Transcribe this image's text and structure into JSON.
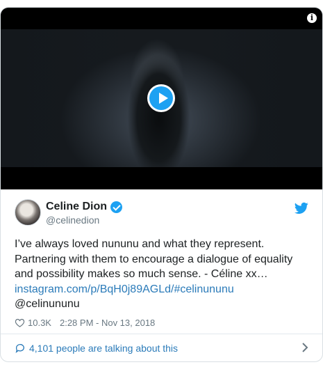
{
  "video": {
    "info_icon_glyph": "i",
    "play_icon": "play-icon"
  },
  "tweet": {
    "author_name": "Celine Dion",
    "handle": "@celinedion",
    "verified": true,
    "text_main": "I’ve always loved nununu and what they represent. Partnering with them to encourage a dialogue of equality and possibility makes so much sense. - Céline xx…",
    "link_text": "instagram.com/p/BqH0j89AGLd/#celinununu",
    "text_after": " @celinununu",
    "likes": "10.3K",
    "timestamp": "2:28 PM - Nov 13, 2018"
  },
  "footer": {
    "talking_text": "4,101 people are talking about this"
  },
  "colors": {
    "twitter_blue": "#1da1f2",
    "link_blue": "#2b7bb9",
    "muted_gray": "#697882"
  }
}
